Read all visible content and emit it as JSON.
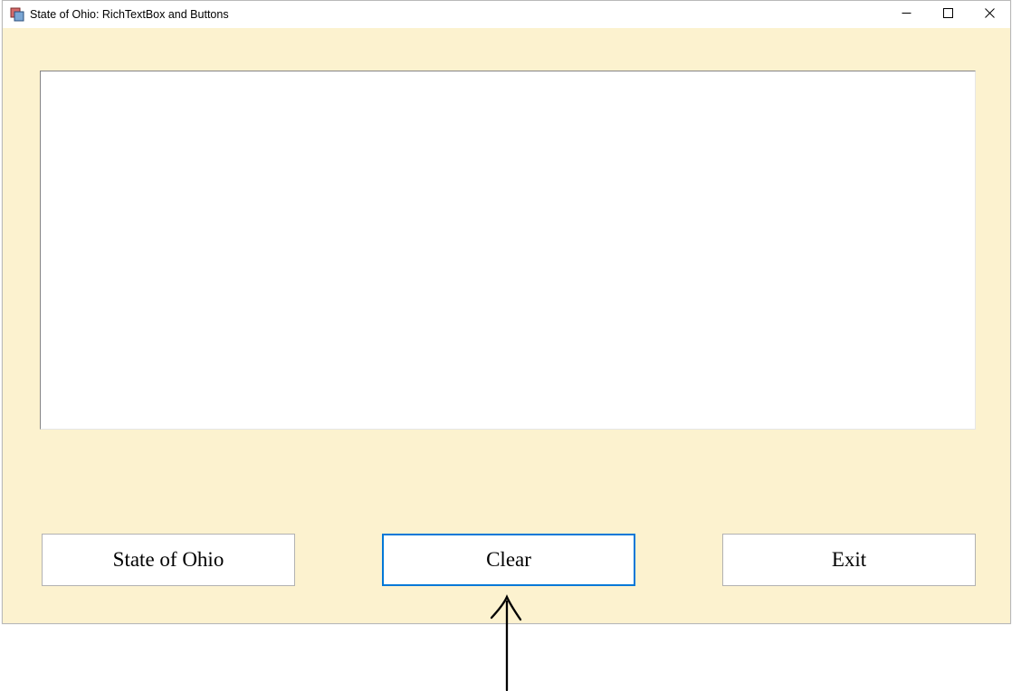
{
  "titlebar": {
    "title": "State of Ohio: RichTextBox and Buttons"
  },
  "richtext": {
    "value": ""
  },
  "buttons": {
    "state_of_ohio": "State of Ohio",
    "clear": "Clear",
    "exit": "Exit"
  }
}
